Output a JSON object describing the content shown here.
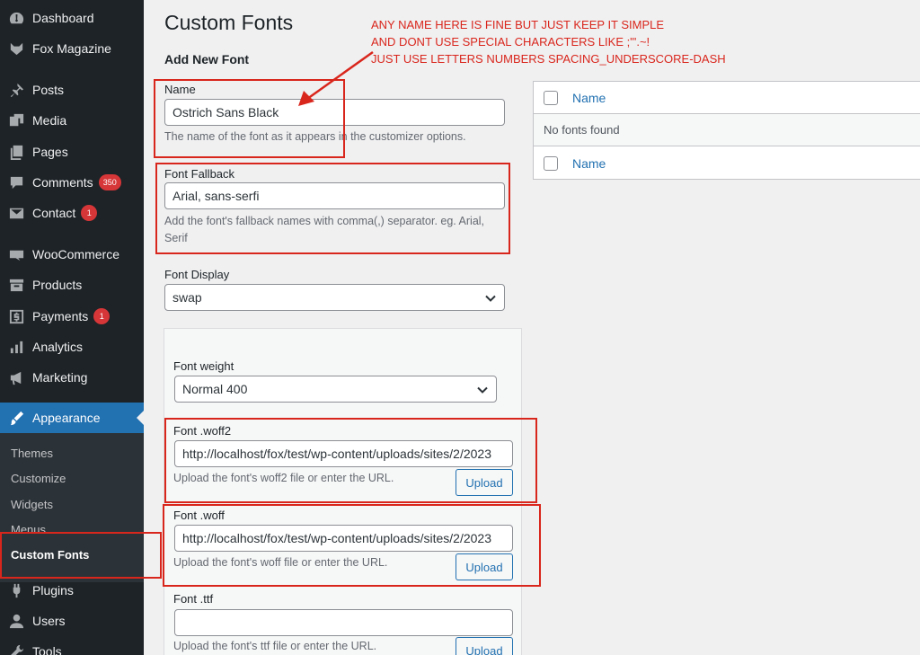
{
  "sidebar": {
    "items": [
      {
        "label": "Dashboard",
        "icon": "dashboard-icon"
      },
      {
        "label": "Fox Magazine",
        "icon": "fox-icon"
      },
      {
        "label": "Posts",
        "icon": "pin-icon"
      },
      {
        "label": "Media",
        "icon": "media-icon"
      },
      {
        "label": "Pages",
        "icon": "pages-icon"
      },
      {
        "label": "Comments",
        "icon": "comment-icon",
        "badge": "350"
      },
      {
        "label": "Contact",
        "icon": "mail-icon",
        "badge": "1"
      },
      {
        "label": "WooCommerce",
        "icon": "woo-icon"
      },
      {
        "label": "Products",
        "icon": "archive-icon"
      },
      {
        "label": "Payments",
        "icon": "dollar-icon",
        "badge": "1"
      },
      {
        "label": "Analytics",
        "icon": "bar-chart-icon"
      },
      {
        "label": "Marketing",
        "icon": "megaphone-icon"
      },
      {
        "label": "Appearance",
        "icon": "brush-icon"
      },
      {
        "label": "Plugins",
        "icon": "plug-icon"
      },
      {
        "label": "Users",
        "icon": "user-icon"
      },
      {
        "label": "Tools",
        "icon": "wrench-icon"
      }
    ],
    "submenu": [
      "Themes",
      "Customize",
      "Widgets",
      "Menus",
      "Custom Fonts"
    ]
  },
  "page": {
    "title": "Custom Fonts",
    "section_title": "Add New Font"
  },
  "form": {
    "name_label": "Name",
    "name_value": "Ostrich Sans Black",
    "name_desc": "The name of the font as it appears in the customizer options.",
    "fallback_label": "Font Fallback",
    "fallback_value": "Arial, sans-serfi",
    "fallback_desc": "Add the font's fallback names with comma(,) separator. eg. Arial, Serif",
    "display_label": "Font Display",
    "display_value": "swap",
    "weight_label": "Font weight",
    "weight_value": "Normal 400",
    "woff2_label": "Font .woff2",
    "woff2_value": "http://localhost/fox/test/wp-content/uploads/sites/2/2023",
    "woff2_desc": "Upload the font's woff2 file or enter the URL.",
    "woff_label": "Font .woff",
    "woff_value": "http://localhost/fox/test/wp-content/uploads/sites/2/2023",
    "woff_desc": "Upload the font's woff file or enter the URL.",
    "ttf_label": "Font .ttf",
    "ttf_value": "",
    "ttf_desc": "Upload the font's ttf file or enter the URL.",
    "upload_label": "Upload"
  },
  "table": {
    "header": "Name",
    "empty": "No fonts found",
    "footer": "Name"
  },
  "annotation": {
    "lines": [
      "ANY NAME HERE IS FINE BUT JUST KEEP IT SIMPLE",
      "AND DONT USE SPECIAL CHARACTERS LIKE ;\"'.~!",
      "JUST USE LETTERS NUMBERS SPACING_UNDERSCORE-DASH"
    ]
  },
  "colors": {
    "sidebar_bg": "#1d2327",
    "submenu_bg": "#2c3338",
    "accent": "#2271b1",
    "badge": "#d63638",
    "annotation": "#d9261c"
  }
}
